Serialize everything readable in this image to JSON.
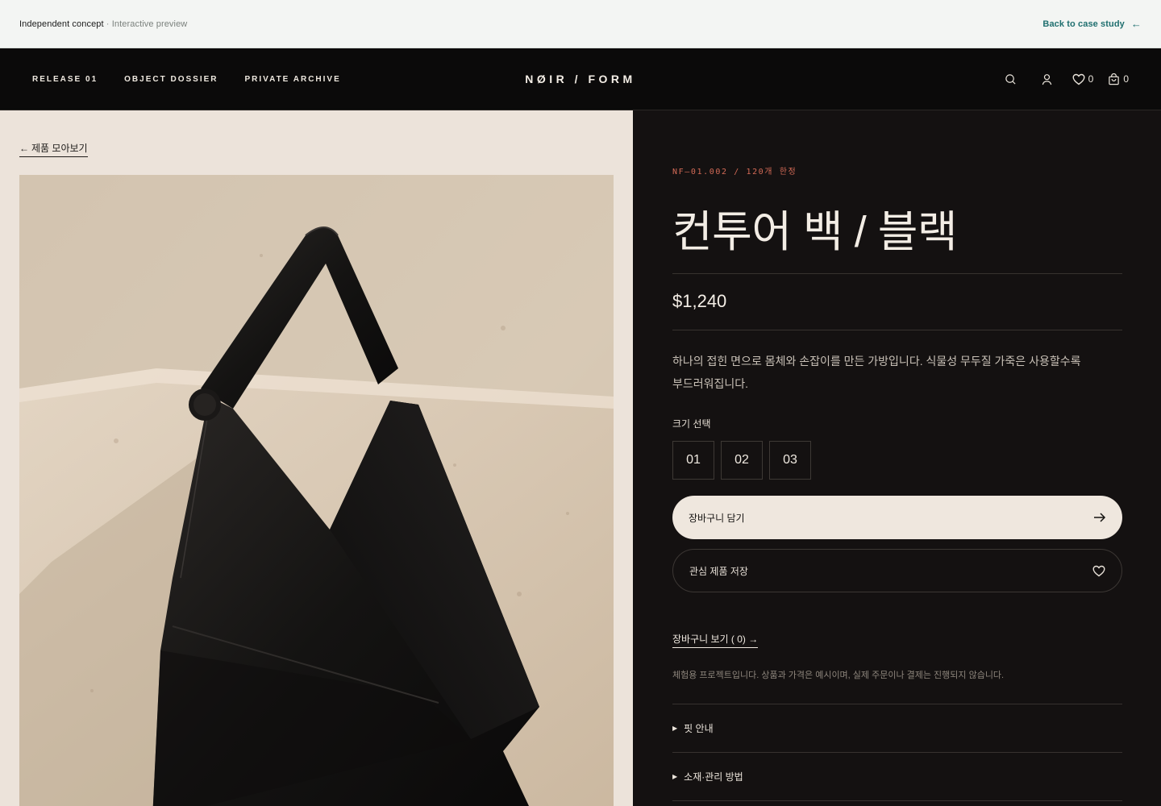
{
  "preview": {
    "concept": "Independent concept",
    "separator": " · ",
    "mode": "Interactive preview",
    "back_label": "Back to case study",
    "back_arrow": "←"
  },
  "header": {
    "nav": [
      "RELEASE 01",
      "OBJECT DOSSIER",
      "PRIVATE ARCHIVE"
    ],
    "logo": "NØIR / FORM",
    "wishlist_count": "0",
    "cart_count": "0",
    "icons": [
      "search-icon",
      "account-icon",
      "heart-icon",
      "bag-icon"
    ]
  },
  "gallery": {
    "back_arrow": "←",
    "back_label": "제품 모아보기"
  },
  "product": {
    "sku": "NF—01.002 / 120개 한정",
    "title": "컨투어 백 / 블랙",
    "price": "$1,240",
    "description": "하나의 접힌 면으로 몸체와 손잡이를 만든 가방입니다. 식물성 무두질 가죽은 사용할수록 부드러워집니다.",
    "size_label": "크기 선택",
    "sizes": [
      "01",
      "02",
      "03"
    ],
    "add_to_cart": "장바구니 담기",
    "save_label": "관심 제품 저장",
    "view_cart": "장바구니 보기 ( 0) →",
    "disclaimer": "체험용 프로젝트입니다. 상품과 가격은 예시이며, 실제 주문이나 결제는 진행되지 않습니다.",
    "accordions": [
      "핏 안내",
      "소재·관리 방법"
    ],
    "accordion_marker": "▶"
  },
  "colors": {
    "accent": "#d36a56",
    "panel": "#141111",
    "gallery_bg": "#ece3da",
    "link": "#1f6f6f"
  }
}
